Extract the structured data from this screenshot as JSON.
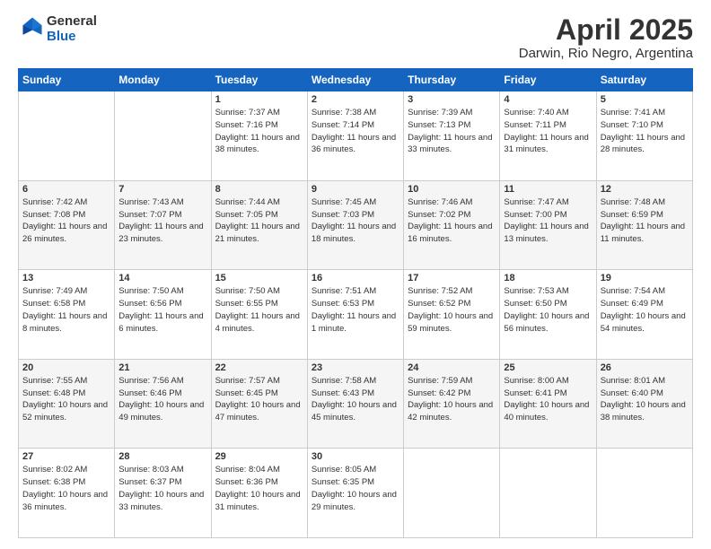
{
  "logo": {
    "general": "General",
    "blue": "Blue"
  },
  "header": {
    "title": "April 2025",
    "subtitle": "Darwin, Rio Negro, Argentina"
  },
  "days_of_week": [
    "Sunday",
    "Monday",
    "Tuesday",
    "Wednesday",
    "Thursday",
    "Friday",
    "Saturday"
  ],
  "weeks": [
    [
      {
        "day": "",
        "sunrise": "",
        "sunset": "",
        "daylight": ""
      },
      {
        "day": "",
        "sunrise": "",
        "sunset": "",
        "daylight": ""
      },
      {
        "day": "1",
        "sunrise": "Sunrise: 7:37 AM",
        "sunset": "Sunset: 7:16 PM",
        "daylight": "Daylight: 11 hours and 38 minutes."
      },
      {
        "day": "2",
        "sunrise": "Sunrise: 7:38 AM",
        "sunset": "Sunset: 7:14 PM",
        "daylight": "Daylight: 11 hours and 36 minutes."
      },
      {
        "day": "3",
        "sunrise": "Sunrise: 7:39 AM",
        "sunset": "Sunset: 7:13 PM",
        "daylight": "Daylight: 11 hours and 33 minutes."
      },
      {
        "day": "4",
        "sunrise": "Sunrise: 7:40 AM",
        "sunset": "Sunset: 7:11 PM",
        "daylight": "Daylight: 11 hours and 31 minutes."
      },
      {
        "day": "5",
        "sunrise": "Sunrise: 7:41 AM",
        "sunset": "Sunset: 7:10 PM",
        "daylight": "Daylight: 11 hours and 28 minutes."
      }
    ],
    [
      {
        "day": "6",
        "sunrise": "Sunrise: 7:42 AM",
        "sunset": "Sunset: 7:08 PM",
        "daylight": "Daylight: 11 hours and 26 minutes."
      },
      {
        "day": "7",
        "sunrise": "Sunrise: 7:43 AM",
        "sunset": "Sunset: 7:07 PM",
        "daylight": "Daylight: 11 hours and 23 minutes."
      },
      {
        "day": "8",
        "sunrise": "Sunrise: 7:44 AM",
        "sunset": "Sunset: 7:05 PM",
        "daylight": "Daylight: 11 hours and 21 minutes."
      },
      {
        "day": "9",
        "sunrise": "Sunrise: 7:45 AM",
        "sunset": "Sunset: 7:03 PM",
        "daylight": "Daylight: 11 hours and 18 minutes."
      },
      {
        "day": "10",
        "sunrise": "Sunrise: 7:46 AM",
        "sunset": "Sunset: 7:02 PM",
        "daylight": "Daylight: 11 hours and 16 minutes."
      },
      {
        "day": "11",
        "sunrise": "Sunrise: 7:47 AM",
        "sunset": "Sunset: 7:00 PM",
        "daylight": "Daylight: 11 hours and 13 minutes."
      },
      {
        "day": "12",
        "sunrise": "Sunrise: 7:48 AM",
        "sunset": "Sunset: 6:59 PM",
        "daylight": "Daylight: 11 hours and 11 minutes."
      }
    ],
    [
      {
        "day": "13",
        "sunrise": "Sunrise: 7:49 AM",
        "sunset": "Sunset: 6:58 PM",
        "daylight": "Daylight: 11 hours and 8 minutes."
      },
      {
        "day": "14",
        "sunrise": "Sunrise: 7:50 AM",
        "sunset": "Sunset: 6:56 PM",
        "daylight": "Daylight: 11 hours and 6 minutes."
      },
      {
        "day": "15",
        "sunrise": "Sunrise: 7:50 AM",
        "sunset": "Sunset: 6:55 PM",
        "daylight": "Daylight: 11 hours and 4 minutes."
      },
      {
        "day": "16",
        "sunrise": "Sunrise: 7:51 AM",
        "sunset": "Sunset: 6:53 PM",
        "daylight": "Daylight: 11 hours and 1 minute."
      },
      {
        "day": "17",
        "sunrise": "Sunrise: 7:52 AM",
        "sunset": "Sunset: 6:52 PM",
        "daylight": "Daylight: 10 hours and 59 minutes."
      },
      {
        "day": "18",
        "sunrise": "Sunrise: 7:53 AM",
        "sunset": "Sunset: 6:50 PM",
        "daylight": "Daylight: 10 hours and 56 minutes."
      },
      {
        "day": "19",
        "sunrise": "Sunrise: 7:54 AM",
        "sunset": "Sunset: 6:49 PM",
        "daylight": "Daylight: 10 hours and 54 minutes."
      }
    ],
    [
      {
        "day": "20",
        "sunrise": "Sunrise: 7:55 AM",
        "sunset": "Sunset: 6:48 PM",
        "daylight": "Daylight: 10 hours and 52 minutes."
      },
      {
        "day": "21",
        "sunrise": "Sunrise: 7:56 AM",
        "sunset": "Sunset: 6:46 PM",
        "daylight": "Daylight: 10 hours and 49 minutes."
      },
      {
        "day": "22",
        "sunrise": "Sunrise: 7:57 AM",
        "sunset": "Sunset: 6:45 PM",
        "daylight": "Daylight: 10 hours and 47 minutes."
      },
      {
        "day": "23",
        "sunrise": "Sunrise: 7:58 AM",
        "sunset": "Sunset: 6:43 PM",
        "daylight": "Daylight: 10 hours and 45 minutes."
      },
      {
        "day": "24",
        "sunrise": "Sunrise: 7:59 AM",
        "sunset": "Sunset: 6:42 PM",
        "daylight": "Daylight: 10 hours and 42 minutes."
      },
      {
        "day": "25",
        "sunrise": "Sunrise: 8:00 AM",
        "sunset": "Sunset: 6:41 PM",
        "daylight": "Daylight: 10 hours and 40 minutes."
      },
      {
        "day": "26",
        "sunrise": "Sunrise: 8:01 AM",
        "sunset": "Sunset: 6:40 PM",
        "daylight": "Daylight: 10 hours and 38 minutes."
      }
    ],
    [
      {
        "day": "27",
        "sunrise": "Sunrise: 8:02 AM",
        "sunset": "Sunset: 6:38 PM",
        "daylight": "Daylight: 10 hours and 36 minutes."
      },
      {
        "day": "28",
        "sunrise": "Sunrise: 8:03 AM",
        "sunset": "Sunset: 6:37 PM",
        "daylight": "Daylight: 10 hours and 33 minutes."
      },
      {
        "day": "29",
        "sunrise": "Sunrise: 8:04 AM",
        "sunset": "Sunset: 6:36 PM",
        "daylight": "Daylight: 10 hours and 31 minutes."
      },
      {
        "day": "30",
        "sunrise": "Sunrise: 8:05 AM",
        "sunset": "Sunset: 6:35 PM",
        "daylight": "Daylight: 10 hours and 29 minutes."
      },
      {
        "day": "",
        "sunrise": "",
        "sunset": "",
        "daylight": ""
      },
      {
        "day": "",
        "sunrise": "",
        "sunset": "",
        "daylight": ""
      },
      {
        "day": "",
        "sunrise": "",
        "sunset": "",
        "daylight": ""
      }
    ]
  ]
}
